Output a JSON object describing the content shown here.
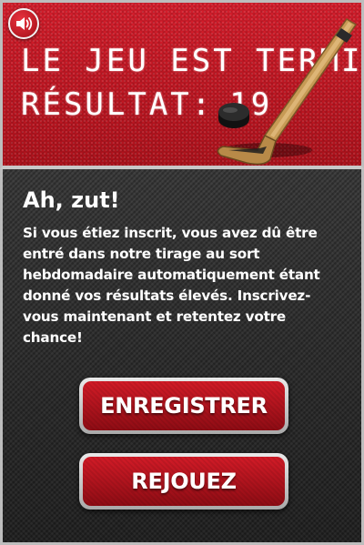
{
  "scoreboard": {
    "line1": "LE JEU EST TERMINÉ",
    "result_label": "RÉSULTAT:",
    "result_value": "19",
    "sound_icon": "speaker-icon",
    "accent_color": "#d81e2c"
  },
  "message": {
    "title": "Ah, zut!",
    "body": "Si vous étiez inscrit, vous avez dû être entré dans notre tirage au sort hebdomadaire automatiquement étant donné vos résultats élevés. Inscrivez-vous maintenant et retentez votre chance!"
  },
  "buttons": {
    "register_label": "ENREGISTRER",
    "replay_label": "REJOUEZ"
  }
}
